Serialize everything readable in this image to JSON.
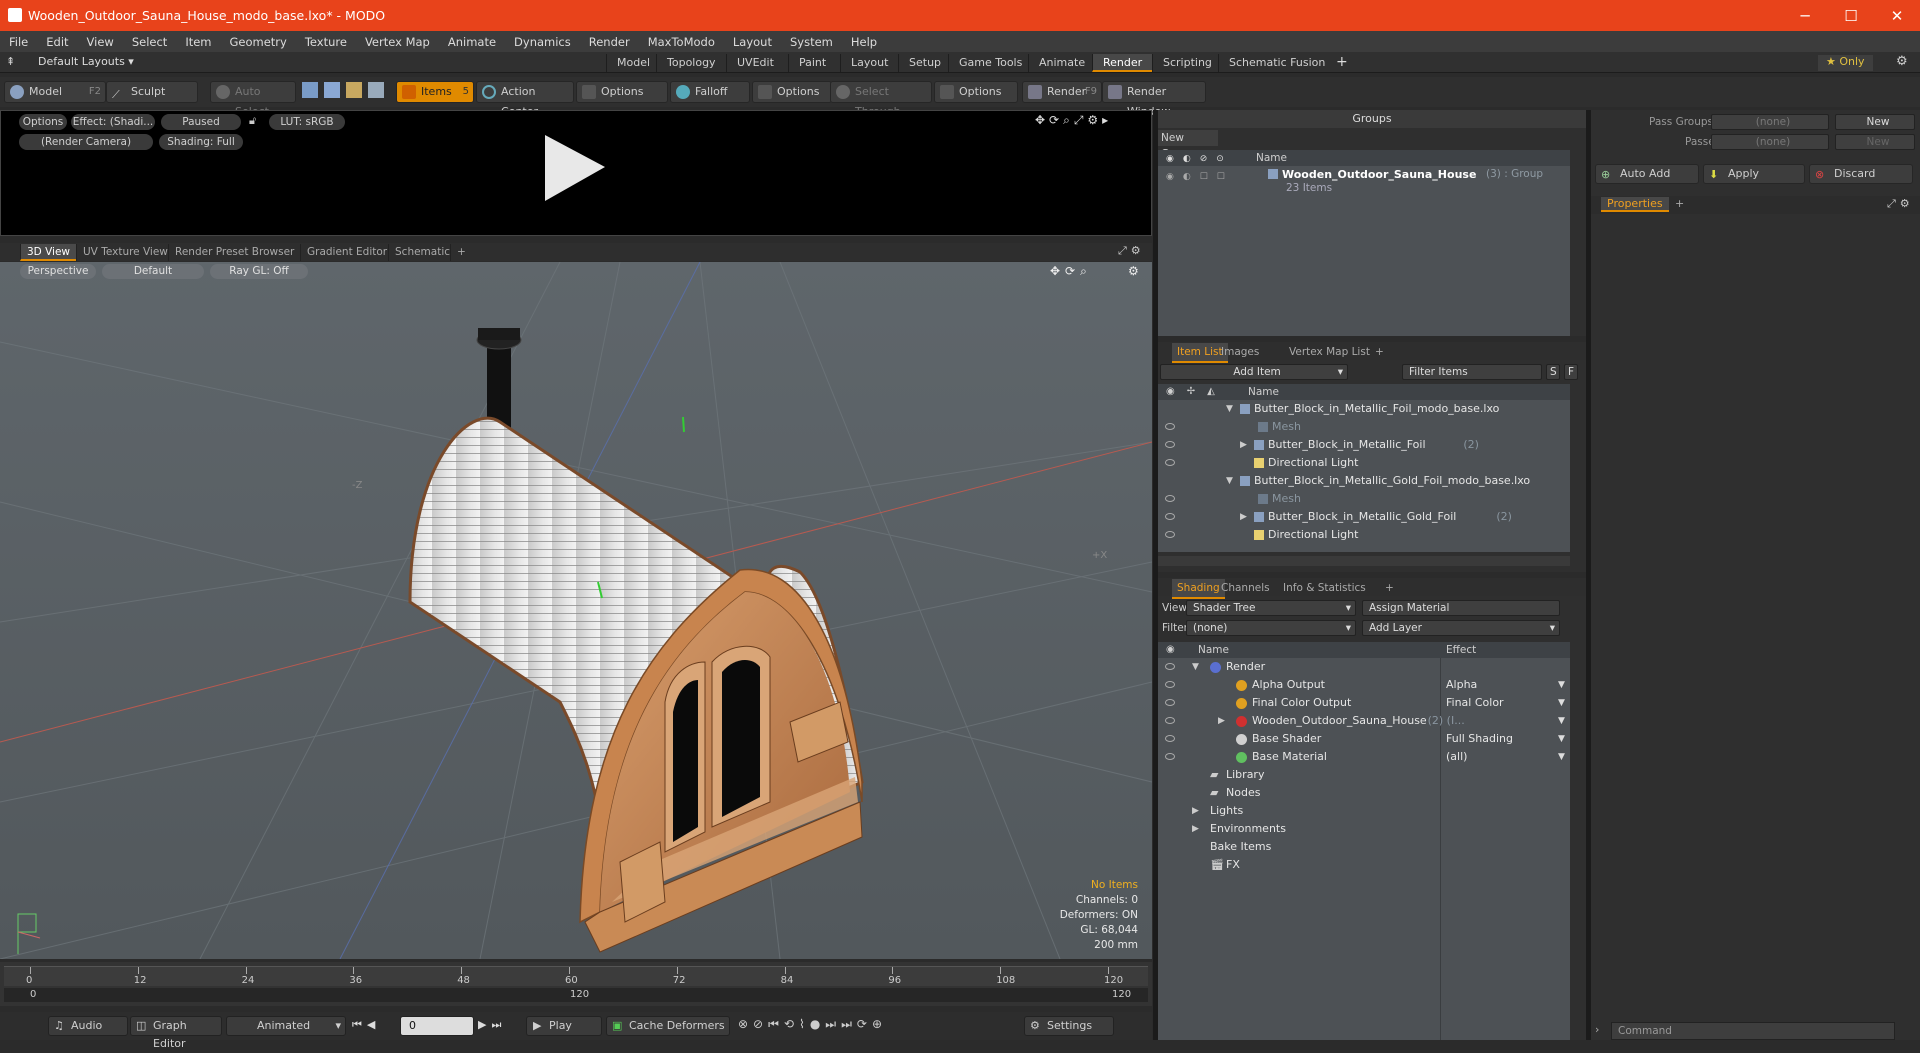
{
  "window": {
    "title": "Wooden_Outdoor_Sauna_House_modo_base.lxo* - MODO",
    "min": "─",
    "max": "☐",
    "close": "✕"
  },
  "menu": [
    "File",
    "Edit",
    "View",
    "Select",
    "Item",
    "Geometry",
    "Texture",
    "Vertex Map",
    "Animate",
    "Dynamics",
    "Render",
    "MaxToModo",
    "Layout",
    "System",
    "Help"
  ],
  "layouts": {
    "default": "Default Layouts ▾",
    "tabs": [
      "Model",
      "Topology",
      "UVEdit",
      "Paint",
      "Layout",
      "Setup",
      "Game Tools",
      "Animate",
      "Render",
      "Scripting",
      "Schematic Fusion"
    ],
    "active": "Render",
    "plus": "+",
    "only": "★ Only"
  },
  "toolbar": {
    "model": "Model",
    "model_key": "F2",
    "sculpt": "Sculpt",
    "auto_select": "Auto Select",
    "items": "Items",
    "items_key": "5",
    "action_center": "Action Center",
    "options1": "Options",
    "falloff": "Falloff",
    "options2": "Options",
    "select_through": "Select Through",
    "options3": "Options",
    "render": "Render",
    "render_key": "F9",
    "render_window": "Render Window"
  },
  "preview": {
    "options": "Options",
    "effect": "Effect: (Shadi...",
    "paused": "Paused",
    "lut": "LUT: sRGB",
    "camera": "(Render Camera)",
    "shading": "Shading: Full"
  },
  "view_tabs": [
    "3D View",
    "UV Texture View",
    "Render Preset Browser",
    "Gradient Editor",
    "Schematic",
    "+"
  ],
  "viewport": {
    "perspective": "Perspective",
    "default": "Default",
    "raygl": "Ray GL: Off",
    "axis_z": "-Z",
    "axis_x": "+X",
    "info": {
      "no_items": "No Items",
      "channels": "Channels: 0",
      "deformers": "Deformers: ON",
      "gl": "GL: 68,044",
      "size": "200 mm"
    }
  },
  "timeline": {
    "ticks": [
      "0",
      "12",
      "24",
      "36",
      "48",
      "60",
      "72",
      "84",
      "96",
      "108",
      "120"
    ],
    "start": "0",
    "end": "120"
  },
  "bottom": {
    "audio": "Audio",
    "graph_editor": "Graph Editor",
    "animated": "Animated",
    "frame": "0",
    "play": "Play",
    "cache": "Cache Deformers",
    "settings": "Settings"
  },
  "groups": {
    "title": "Groups",
    "new_group": "New Group",
    "name_col": "Name",
    "item_name": "Wooden_Outdoor_Sauna_House",
    "item_suffix": "(3) : Group",
    "item_count": "23 Items"
  },
  "itemlist": {
    "tabs": [
      "Item List",
      "Images",
      "Vertex Map List",
      "+"
    ],
    "add_item": "Add Item",
    "filter": "Filter Items",
    "s": "S",
    "f": "F",
    "name_col": "Name",
    "rows": [
      {
        "label": "Butter_Block_in_Metallic_Foil_modo_base.lxo",
        "indent": 0,
        "dim": false
      },
      {
        "label": "Mesh",
        "indent": 2,
        "dim": true
      },
      {
        "label": "Butter_Block_in_Metallic_Foil",
        "suffix": "(2)",
        "indent": 1,
        "dim": false
      },
      {
        "label": "Directional Light",
        "indent": 1,
        "dim": false
      },
      {
        "label": "Butter_Block_in_Metallic_Gold_Foil_modo_base.lxo",
        "indent": 0,
        "dim": false
      },
      {
        "label": "Mesh",
        "indent": 2,
        "dim": true
      },
      {
        "label": "Butter_Block_in_Metallic_Gold_Foil",
        "suffix": "(2)",
        "indent": 1,
        "dim": false
      },
      {
        "label": "Directional Light",
        "indent": 1,
        "dim": false
      }
    ]
  },
  "shading": {
    "tabs": [
      "Shading",
      "Channels",
      "Info & Statistics",
      "+"
    ],
    "view_label": "View",
    "view_value": "Shader Tree",
    "assign": "Assign Material",
    "filter_label": "Filter",
    "filter_value": "(none)",
    "add_layer": "Add Layer",
    "name_col": "Name",
    "effect_col": "Effect",
    "rows": [
      {
        "label": "Render",
        "effect": "",
        "indent": 0
      },
      {
        "label": "Alpha Output",
        "effect": "Alpha",
        "indent": 1
      },
      {
        "label": "Final Color Output",
        "effect": "Final Color",
        "indent": 1
      },
      {
        "label": "Wooden_Outdoor_Sauna_House",
        "suffix": "(2) (I...",
        "effect": "",
        "indent": 1
      },
      {
        "label": "Base Shader",
        "effect": "Full Shading",
        "indent": 1
      },
      {
        "label": "Base Material",
        "effect": "(all)",
        "indent": 1
      },
      {
        "label": "Library",
        "effect": "",
        "indent": 0
      },
      {
        "label": "Nodes",
        "effect": "",
        "indent": 0
      },
      {
        "label": "Lights",
        "effect": "",
        "indent": 0
      },
      {
        "label": "Environments",
        "effect": "",
        "indent": 0
      },
      {
        "label": "Bake Items",
        "effect": "",
        "indent": 0
      },
      {
        "label": "FX",
        "effect": "",
        "indent": 0
      }
    ]
  },
  "right": {
    "pass_groups": "Pass Groups",
    "passes": "Passes",
    "none": "(none)",
    "new": "New",
    "auto_add": "Auto Add",
    "apply": "Apply",
    "discard": "Discard",
    "properties": "Properties",
    "plus": "+",
    "command": "Command"
  }
}
